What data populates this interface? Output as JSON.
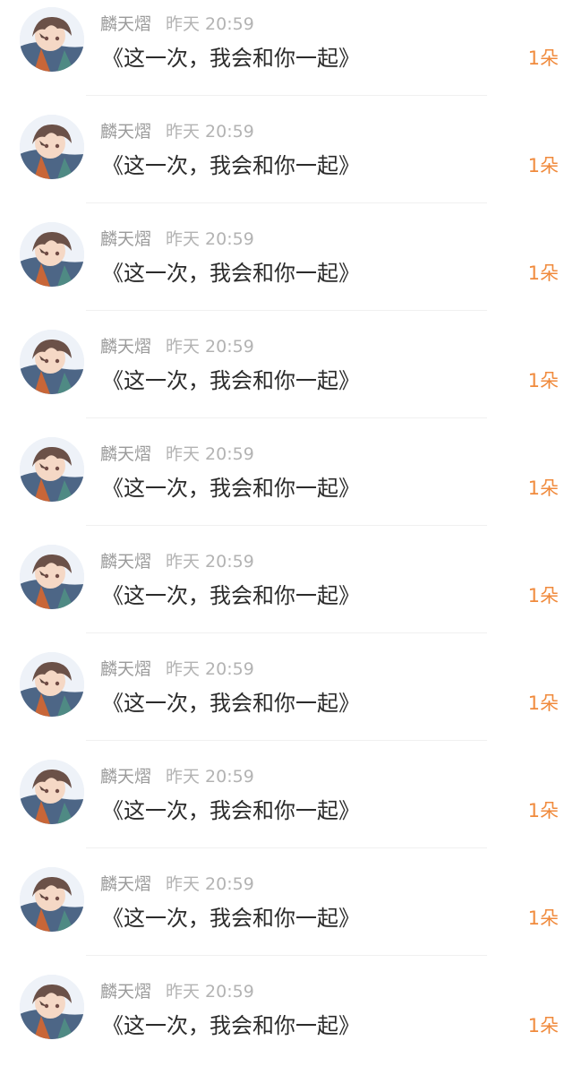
{
  "comments": [
    {
      "username": "麟天熠",
      "time": "昨天 20:59",
      "text": "《这一次，我会和你一起》",
      "count": "1朵",
      "avatar_icon": "anime-avatar"
    },
    {
      "username": "麟天熠",
      "time": "昨天 20:59",
      "text": "《这一次，我会和你一起》",
      "count": "1朵",
      "avatar_icon": "anime-avatar"
    },
    {
      "username": "麟天熠",
      "time": "昨天 20:59",
      "text": "《这一次，我会和你一起》",
      "count": "1朵",
      "avatar_icon": "anime-avatar"
    },
    {
      "username": "麟天熠",
      "time": "昨天 20:59",
      "text": "《这一次，我会和你一起》",
      "count": "1朵",
      "avatar_icon": "anime-avatar"
    },
    {
      "username": "麟天熠",
      "time": "昨天 20:59",
      "text": "《这一次，我会和你一起》",
      "count": "1朵",
      "avatar_icon": "anime-avatar"
    },
    {
      "username": "麟天熠",
      "time": "昨天 20:59",
      "text": "《这一次，我会和你一起》",
      "count": "1朵",
      "avatar_icon": "anime-avatar"
    },
    {
      "username": "麟天熠",
      "time": "昨天 20:59",
      "text": "《这一次，我会和你一起》",
      "count": "1朵",
      "avatar_icon": "anime-avatar"
    },
    {
      "username": "麟天熠",
      "time": "昨天 20:59",
      "text": "《这一次，我会和你一起》",
      "count": "1朵",
      "avatar_icon": "anime-avatar"
    },
    {
      "username": "麟天熠",
      "time": "昨天 20:59",
      "text": "《这一次，我会和你一起》",
      "count": "1朵",
      "avatar_icon": "anime-avatar"
    },
    {
      "username": "麟天熠",
      "time": "昨天 20:59",
      "text": "《这一次，我会和你一起》",
      "count": "1朵",
      "avatar_icon": "anime-avatar"
    }
  ],
  "colors": {
    "count": "#f08a3c",
    "username": "#9b9b9b",
    "time": "#b3b3b3",
    "text": "#2b2b2b",
    "divider": "#f0f0f0"
  }
}
